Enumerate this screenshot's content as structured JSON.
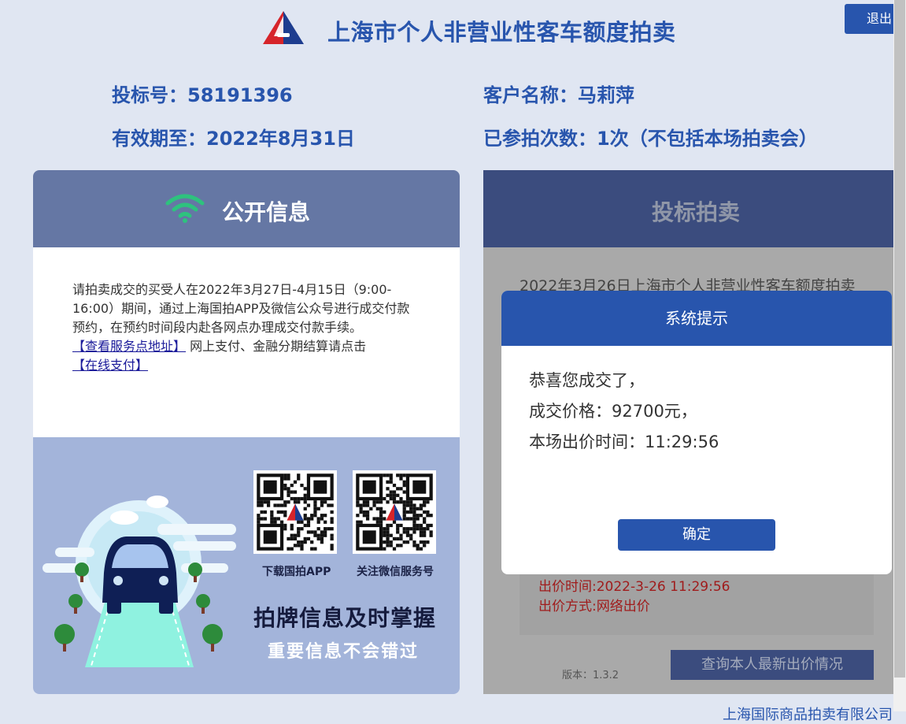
{
  "header": {
    "title": "上海市个人非营业性客车额度拍卖",
    "logout_label": "退出"
  },
  "user": {
    "bid_number_label": "投标号：",
    "bid_number": "58191396",
    "valid_until_label": "有效期至：",
    "valid_until": "2022年8月31日",
    "customer_label": "客户名称：",
    "customer_name": "马莉萍",
    "attempts_label": "已参拍次数：",
    "attempts": "1次（不包括本场拍卖会）"
  },
  "public_info": {
    "title": "公开信息",
    "notice": "请拍卖成交的买受人在2022年3月27日-4月15日（9:00-16:00）期间，通过上海国拍APP及微信公众号进行成交付款预约，在预约时间段内赴各网点办理成交付款手续。",
    "service_link": "【查看服务点地址】",
    "payment_text": "网上支付、金融分期结算请点击",
    "online_pay_link": "【在线支付】",
    "qr_app_caption": "下载国拍APP",
    "qr_wechat_caption": "关注微信服务号",
    "slogan_main": "拍牌信息及时掌握",
    "slogan_sub": "重要信息不会错过"
  },
  "auction": {
    "title": "投标拍卖",
    "auction_line": "2022年3月26日上海市个人非营业性客车额度拍卖",
    "bid_time": "出价时间:2022-3-26 11:29:56",
    "bid_method": "出价方式:网络出价",
    "version": "版本：1.3.2",
    "query_button": "查询本人最新出价情况"
  },
  "dialog": {
    "title": "系统提示",
    "line1": "恭喜您成交了，",
    "line2": "成交价格：92700元，",
    "line3": "本场出价时间：11:29:56",
    "ok_label": "确定"
  },
  "footer": {
    "company": "上海国际商品拍卖有限公司"
  },
  "colors": {
    "brand_blue": "#2855ad",
    "panel_header": "#6577a4",
    "overlay_gray": "#a9a9a9",
    "alert_red": "#a01c1c",
    "wifi_green": "#2ec27e"
  }
}
